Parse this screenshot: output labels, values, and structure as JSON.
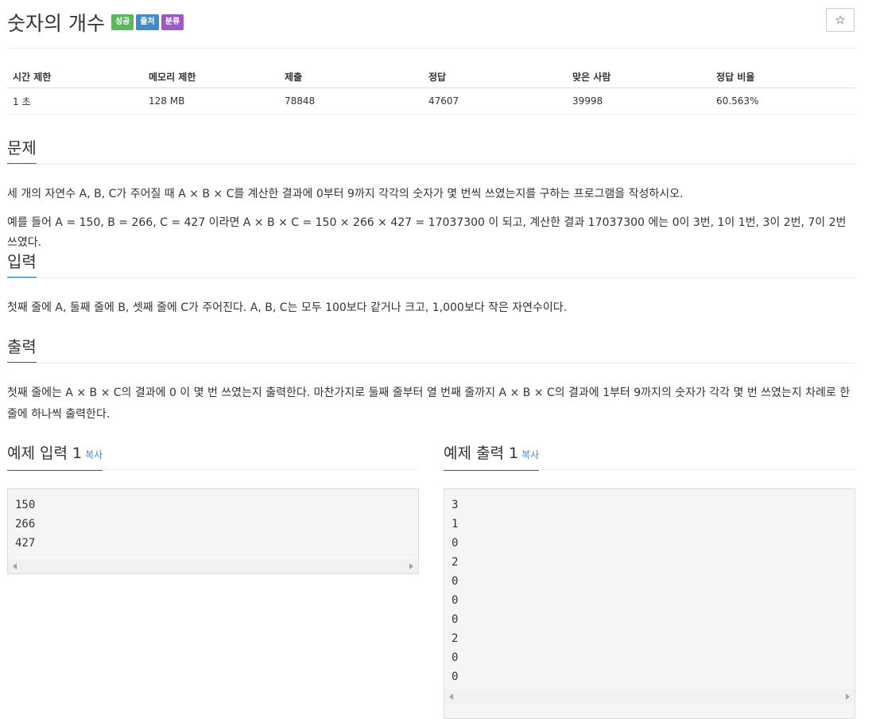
{
  "title": "숫자의 개수",
  "badges": [
    {
      "label": "성공",
      "color": "#5cb85c"
    },
    {
      "label": "출처",
      "color": "#428bca"
    },
    {
      "label": "분류",
      "color": "#9b59c6"
    }
  ],
  "star_icon": "☆",
  "info_table": {
    "headers": [
      "시간 제한",
      "메모리 제한",
      "제출",
      "정답",
      "맞은 사람",
      "정답 비율"
    ],
    "values": [
      "1 초",
      "128 MB",
      "78848",
      "47607",
      "39998",
      "60.563%"
    ]
  },
  "problem": {
    "heading": "문제",
    "lines": [
      "세 개의 자연수 A, B, C가 주어질 때 A × B × C를 계산한 결과에 0부터 9까지 각각의 숫자가 몇 번씩 쓰였는지를 구하는 프로그램을 작성하시오.",
      "예를 들어 A = 150, B = 266, C = 427 이라면 A × B × C = 150 × 266 × 427 = 17037300 이 되고, 계산한 결과 17037300 에는 0이 3번, 1이 1번, 3이 2번, 7이 2번 쓰였다."
    ]
  },
  "input": {
    "heading": "입력",
    "text": "첫째 줄에 A, 둘째 줄에 B, 셋째 줄에 C가 주어진다. A, B, C는 모두 100보다 같거나 크고, 1,000보다 작은 자연수이다."
  },
  "output": {
    "heading": "출력",
    "text": "첫째 줄에는 A × B × C의 결과에 0 이 몇 번 쓰였는지 출력한다. 마찬가지로 둘째 줄부터 열 번째 줄까지 A × B × C의 결과에 1부터 9까지의 숫자가 각각 몇 번 쓰였는지 차례로 한 줄에 하나씩 출력한다."
  },
  "sample_input": {
    "heading": "예제 입력 1",
    "copy_label": "복사",
    "lines": [
      "150",
      "266",
      "427"
    ]
  },
  "sample_output": {
    "heading": "예제 출력 1",
    "copy_label": "복사",
    "lines": [
      "3",
      "1",
      "0",
      "2",
      "0",
      "0",
      "0",
      "2",
      "0",
      "0"
    ]
  }
}
